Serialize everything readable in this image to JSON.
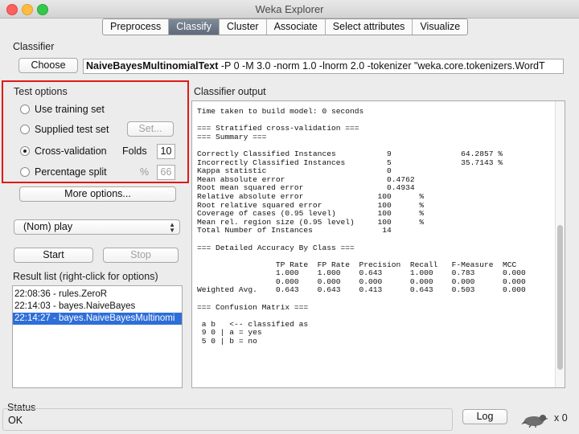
{
  "window": {
    "title": "Weka Explorer"
  },
  "tabs": [
    {
      "label": "Preprocess"
    },
    {
      "label": "Classify"
    },
    {
      "label": "Cluster"
    },
    {
      "label": "Associate"
    },
    {
      "label": "Select attributes"
    },
    {
      "label": "Visualize"
    }
  ],
  "classifier": {
    "section_label": "Classifier",
    "choose_label": "Choose",
    "name": "NaiveBayesMultinomialText",
    "options": " -P 0 -M 3.0 -norm 1.0 -lnorm 2.0 -tokenizer \"weka.core.tokenizers.WordT"
  },
  "test_options": {
    "section_label": "Test options",
    "use_training_set": "Use training set",
    "supplied_test_set": "Supplied test set",
    "set_button": "Set...",
    "cross_validation": "Cross-validation",
    "folds_label": "Folds",
    "folds_value": "10",
    "percentage_split": "Percentage split",
    "percent_symbol": "%",
    "percent_value": "66",
    "selected": "Cross-validation",
    "more_options": "More options..."
  },
  "class_attribute": {
    "value": "(Nom) play"
  },
  "actions": {
    "start": "Start",
    "stop": "Stop"
  },
  "result_list": {
    "label": "Result list (right-click for options)",
    "items": [
      "22:08:36 - rules.ZeroR",
      "22:14:03 - bayes.NaiveBayes",
      "22:14:27 - bayes.NaiveBayesMultinomi"
    ]
  },
  "output": {
    "label": "Classifier output",
    "text": "Time taken to build model: 0 seconds\n\n=== Stratified cross-validation ===\n=== Summary ===\n\nCorrectly Classified Instances           9               64.2857 %\nIncorrectly Classified Instances         5               35.7143 %\nKappa statistic                          0\nMean absolute error                      0.4762\nRoot mean squared error                  0.4934\nRelative absolute error                100      %\nRoot relative squared error            100      %\nCoverage of cases (0.95 level)         100      %\nMean rel. region size (0.95 level)     100      %\nTotal Number of Instances               14\n\n=== Detailed Accuracy By Class ===\n\n                 TP Rate  FP Rate  Precision  Recall   F-Measure  MCC\n                 1.000    1.000    0.643      1.000    0.783      0.000\n                 0.000    0.000    0.000      0.000    0.000      0.000\nWeighted Avg.    0.643    0.643    0.413      0.643    0.503      0.000\n\n=== Confusion Matrix ===\n\n a b   <-- classified as\n 9 0 | a = yes\n 5 0 | b = no"
  },
  "status": {
    "label": "Status",
    "text": "OK",
    "log_button": "Log",
    "count": "x 0"
  }
}
